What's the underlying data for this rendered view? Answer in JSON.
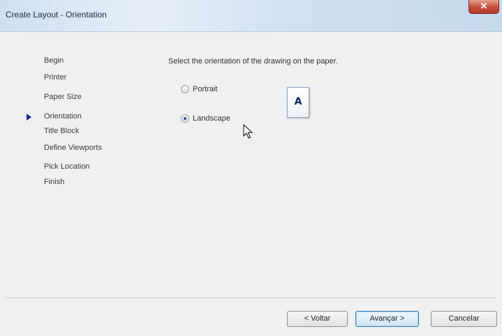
{
  "window": {
    "title": "Create Layout - Orientation",
    "close_glyph": "✕"
  },
  "steps": [
    {
      "label": "Begin",
      "current": false
    },
    {
      "label": "Printer",
      "current": false
    },
    {
      "label": "Paper Size",
      "current": false
    },
    {
      "label": "Orientation",
      "current": true
    },
    {
      "label": "Title Block",
      "current": false
    },
    {
      "label": "Define Viewports",
      "current": false
    },
    {
      "label": "Pick Location",
      "current": false
    },
    {
      "label": "Finish",
      "current": false
    }
  ],
  "main": {
    "instruction": "Select the orientation of the drawing on the paper.",
    "options": [
      {
        "label": "Portrait",
        "checked": false
      },
      {
        "label": "Landscape",
        "checked": true
      }
    ],
    "preview_glyph": "A"
  },
  "buttons": {
    "back": "< Voltar",
    "next": "Avançar >",
    "cancel": "Cancelar"
  },
  "colors": {
    "accent": "#1a2a9a",
    "close": "#c7533f"
  }
}
